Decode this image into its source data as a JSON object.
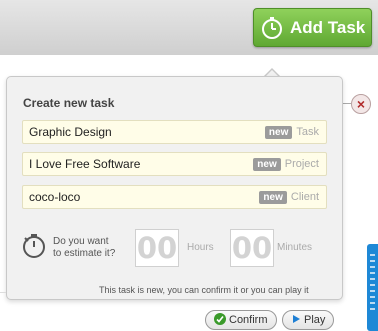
{
  "header": {
    "add_task_label": "Add Task"
  },
  "popover": {
    "title": "Create new task",
    "fields": [
      {
        "value": "Graphic Design",
        "badge": "new",
        "type": "Task"
      },
      {
        "value": "I Love Free Software",
        "badge": "new",
        "type": "Project"
      },
      {
        "value": "coco-loco",
        "badge": "new",
        "type": "Client"
      }
    ],
    "estimate": {
      "label_line1": "Do you want",
      "label_line2": "to estimate it?",
      "hours_value": "00",
      "hours_unit": "Hours",
      "minutes_value": "00",
      "minutes_unit": "Minutes"
    },
    "hint": "This task is new, you can confirm it or you can play it"
  },
  "actions": {
    "confirm_label": "Confirm",
    "play_label": "Play"
  },
  "close_symbol": "×",
  "colors": {
    "add_task_green": "#6bb83b",
    "field_bg": "#fffde8",
    "badge_gray": "#9b9b9b",
    "side_tab_blue": "#1e88d6"
  },
  "icons": {
    "add_task": "stopwatch-icon",
    "estimate": "stopwatch-icon",
    "confirm": "checkmark-icon",
    "play": "play-icon",
    "close": "close-icon"
  }
}
